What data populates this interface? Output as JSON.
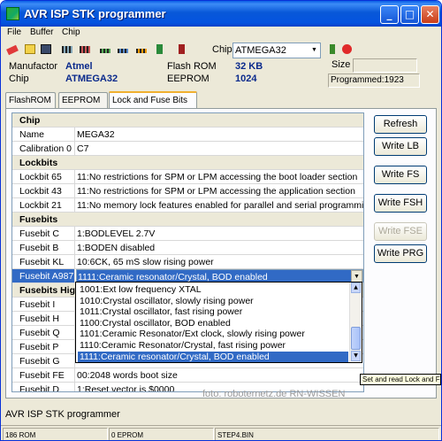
{
  "window": {
    "title": "AVR ISP STK programmer",
    "minimize": "_",
    "maximize": "□",
    "close": "✕"
  },
  "menu": [
    "File",
    "Buffer",
    "Chip"
  ],
  "toolbar": {
    "chip_label": "Chip",
    "chip_value": "ATMEGA32"
  },
  "info": {
    "manufactor_label": "Manufactor",
    "manufactor_value": "Atmel",
    "chip_label": "Chip",
    "chip_value": "ATMEGA32",
    "flashrom_label": "Flash ROM",
    "flashrom_value": "32 KB",
    "eeprom_label": "EEPROM",
    "eeprom_value": "1024",
    "size_label": "Size",
    "size_value": "",
    "programmed": "Programmed:1923"
  },
  "tabs": [
    "FlashROM",
    "EEPROM",
    "Lock and Fuse Bits"
  ],
  "grid": {
    "rows": [
      {
        "type": "header",
        "label": "Chip"
      },
      {
        "label": "Name",
        "value": "MEGA32"
      },
      {
        "label": "Calibration 0",
        "value": "C7"
      },
      {
        "type": "header",
        "label": "Lockbits"
      },
      {
        "label": "Lockbit 65",
        "value": "11:No restrictions for SPM or LPM accessing the boot loader section"
      },
      {
        "label": "Lockbit 43",
        "value": "11:No restrictions for SPM or LPM accessing the application section"
      },
      {
        "label": "Lockbit 21",
        "value": "11:No memory lock features enabled for parallel and serial programming"
      },
      {
        "type": "header",
        "label": "Fusebits"
      },
      {
        "label": "Fusebit C",
        "value": "1:BODLEVEL 2.7V"
      },
      {
        "label": "Fusebit B",
        "value": "1:BODEN disabled"
      },
      {
        "label": "Fusebit KL",
        "value": "10:6CK, 65 mS slow rising power"
      },
      {
        "label": "Fusebit A987",
        "value": "1111:Ceramic resonator/Crystal, BOD enabled",
        "selected": true
      },
      {
        "type": "header",
        "label": "Fusebits High"
      },
      {
        "label": "Fusebit I",
        "value": ""
      },
      {
        "label": "Fusebit H",
        "value": ""
      },
      {
        "label": "Fusebit Q",
        "value": ""
      },
      {
        "label": "Fusebit P",
        "value": ""
      },
      {
        "label": "Fusebit G",
        "value": ""
      },
      {
        "label": "Fusebit FE",
        "value": "00:2048 words boot size"
      },
      {
        "label": "Fusebit D",
        "value": "1:Reset vector is $0000"
      }
    ]
  },
  "dropdown": {
    "options": [
      "1001:Ext low frequency XTAL",
      "1010:Crystal oscillator, slowly rising power",
      "1011:Crystal oscillator, fast rising power",
      "1100:Crystal oscillator, BOD enabled",
      "1101:Ceramic Resonator/Ext clock, slowly rising power",
      "1110:Ceramic Resonator/Crystal, fast rising power",
      "1111:Ceramic resonator/Crystal, BOD enabled"
    ],
    "selected_index": 6
  },
  "buttons": {
    "refresh": "Refresh",
    "write_lb": "Write LB",
    "write_fs": "Write FS",
    "write_fsh": "Write FSH",
    "write_fse": "Write FSE",
    "write_prg": "Write PRG"
  },
  "tooltip": "Set and read Lock and Fuse bits",
  "watermark": "foto: roboternetz.de  RN-WISSEN",
  "status": {
    "message": "AVR ISP STK programmer",
    "rom": "186 ROM",
    "eprom": "0 EPROM",
    "file": "STEP4.BIN"
  }
}
